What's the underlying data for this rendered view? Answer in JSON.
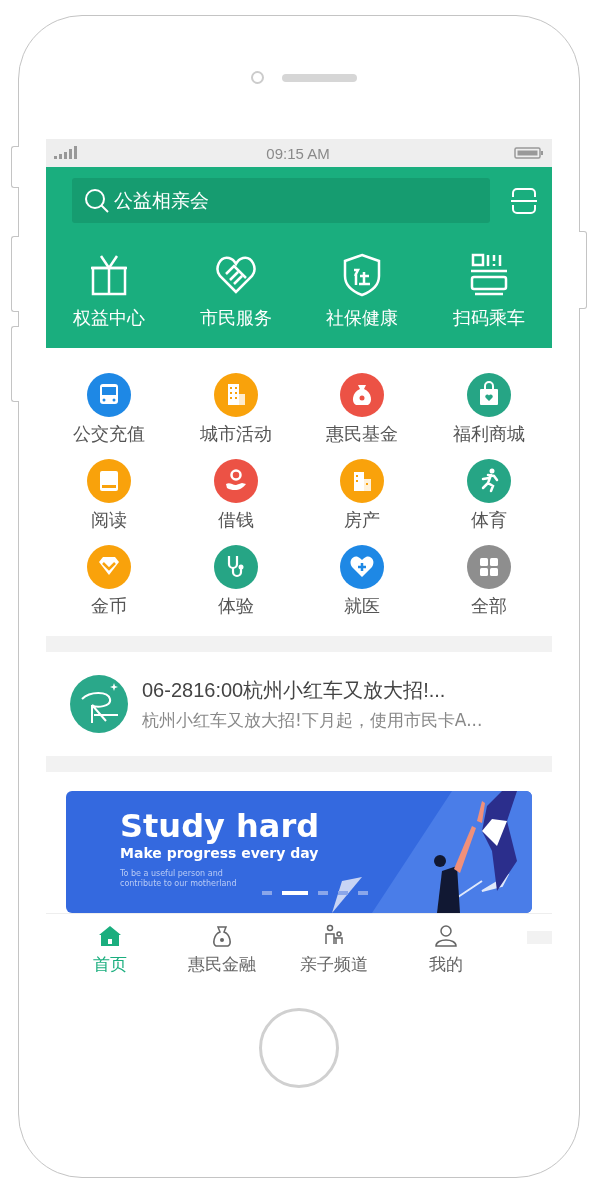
{
  "status_bar": {
    "time": "09:15 AM"
  },
  "search": {
    "value": "公益相亲会"
  },
  "quick_actions": [
    {
      "label": "权益中心"
    },
    {
      "label": "市民服务"
    },
    {
      "label": "社保健康"
    },
    {
      "label": "扫码乘车"
    }
  ],
  "services": [
    {
      "label": "公交充值",
      "color": "#1e88e5"
    },
    {
      "label": "城市活动",
      "color": "#f9a20b"
    },
    {
      "label": "惠民基金",
      "color": "#ec5245"
    },
    {
      "label": "福利商城",
      "color": "#26a585"
    },
    {
      "label": "阅读",
      "color": "#f9a20b"
    },
    {
      "label": "借钱",
      "color": "#ec5245"
    },
    {
      "label": "房产",
      "color": "#f9a20b"
    },
    {
      "label": "体育",
      "color": "#26a585"
    },
    {
      "label": "金币",
      "color": "#f9a20b"
    },
    {
      "label": "体验",
      "color": "#26a585"
    },
    {
      "label": "就医",
      "color": "#1e88e5"
    },
    {
      "label": "全部",
      "color": "#8e8e8e"
    }
  ],
  "news": {
    "title": "06-2816:00杭州小红车又放大招!...",
    "summary": "杭州小红车又放大招!下月起，使用市民卡A..."
  },
  "banner": {
    "title": "Study hard",
    "subtitle": "Make progress every day",
    "note": "To be a useful person and contribute to our motherland",
    "dots": [
      {
        "selected": false
      },
      {
        "selected": true
      },
      {
        "selected": false
      },
      {
        "selected": false
      },
      {
        "selected": false
      }
    ]
  },
  "tabs": [
    {
      "label": "首页",
      "selected": true
    },
    {
      "label": "惠民金融",
      "selected": false
    },
    {
      "label": "亲子频道",
      "selected": false
    },
    {
      "label": "我的",
      "selected": false
    }
  ]
}
